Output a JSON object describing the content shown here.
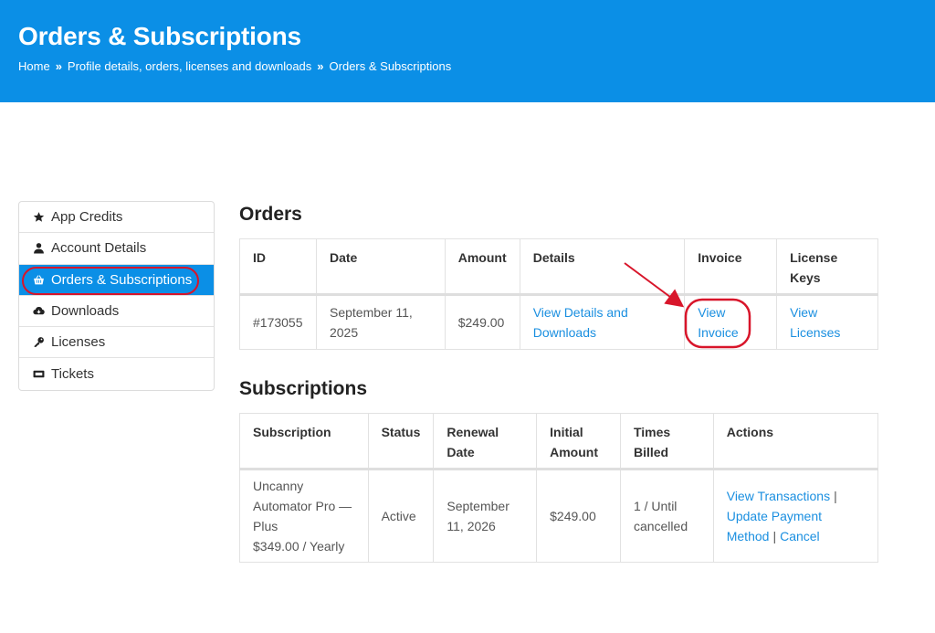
{
  "header": {
    "title": "Orders & Subscriptions",
    "breadcrumb": [
      "Home",
      "Profile details, orders, licenses and downloads",
      "Orders & Subscriptions"
    ],
    "separator": "»"
  },
  "sidebar": {
    "items": [
      {
        "label": "App Credits",
        "icon": "star-icon"
      },
      {
        "label": "Account Details",
        "icon": "user-icon"
      },
      {
        "label": "Orders & Subscriptions",
        "icon": "basket-icon"
      },
      {
        "label": "Downloads",
        "icon": "cloud-download-icon"
      },
      {
        "label": "Licenses",
        "icon": "key-icon"
      },
      {
        "label": "Tickets",
        "icon": "ticket-icon"
      }
    ],
    "active_index": 2
  },
  "orders": {
    "title": "Orders",
    "columns": [
      "ID",
      "Date",
      "Amount",
      "Details",
      "Invoice",
      "License Keys"
    ],
    "rows": [
      {
        "id": "#173055",
        "date": "September 11, 2025",
        "amount": "$249.00",
        "details_link": "View Details and Downloads",
        "invoice_link": "View Invoice",
        "license_link": "View Licenses"
      }
    ]
  },
  "subscriptions": {
    "title": "Subscriptions",
    "columns": [
      "Subscription",
      "Status",
      "Renewal Date",
      "Initial Amount",
      "Times Billed",
      "Actions"
    ],
    "rows": [
      {
        "subscription": "Uncanny Automator Pro — Plus",
        "price": "$349.00 / Yearly",
        "status": "Active",
        "renewal_date": "September 11, 2026",
        "initial_amount": "$249.00",
        "times_billed": "1 / Until cancelled",
        "actions": [
          "View Transactions",
          "Update Payment Method",
          "Cancel"
        ],
        "action_separator": "|"
      }
    ]
  },
  "colors": {
    "header_bg": "#0b8fe6",
    "link": "#1a8fe0",
    "annotation": "#d8152a"
  }
}
